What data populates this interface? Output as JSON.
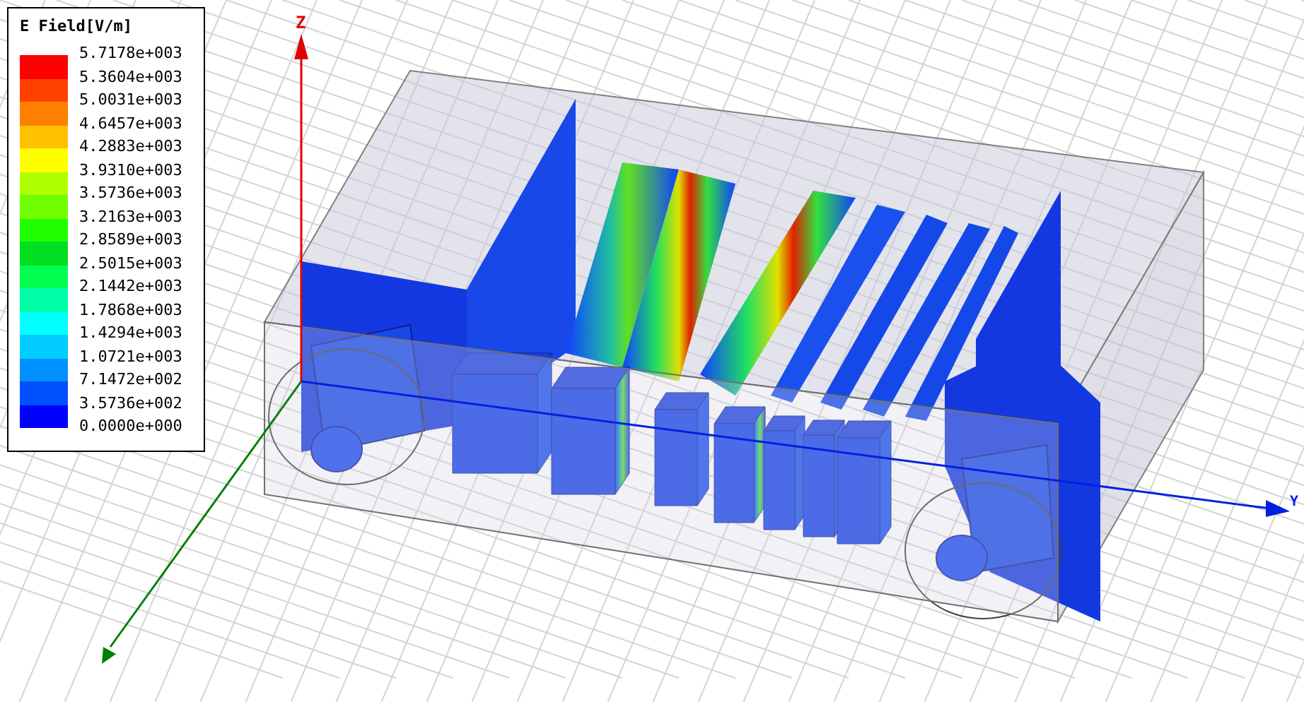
{
  "legend": {
    "title": "E Field[V/m]",
    "bands": [
      {
        "color": "#ff0000"
      },
      {
        "color": "#ff4000"
      },
      {
        "color": "#ff8000"
      },
      {
        "color": "#ffc000"
      },
      {
        "color": "#ffff00"
      },
      {
        "color": "#b0ff00"
      },
      {
        "color": "#70ff00"
      },
      {
        "color": "#20ff00"
      },
      {
        "color": "#00e020"
      },
      {
        "color": "#00ff50"
      },
      {
        "color": "#00ffa8"
      },
      {
        "color": "#00ffff"
      },
      {
        "color": "#00ccff"
      },
      {
        "color": "#0090ff"
      },
      {
        "color": "#0050ff"
      },
      {
        "color": "#0000ff"
      }
    ],
    "labels": [
      "5.7178e+003",
      "5.3604e+003",
      "5.0031e+003",
      "4.6457e+003",
      "4.2883e+003",
      "3.9310e+003",
      "3.5736e+003",
      "3.2163e+003",
      "2.8589e+003",
      "2.5015e+003",
      "2.1442e+003",
      "1.7868e+003",
      "1.4294e+003",
      "1.0721e+003",
      "7.1472e+002",
      "3.5736e+002",
      "0.0000e+000"
    ]
  },
  "axes": [
    {
      "kind": "z",
      "label": "Z"
    },
    {
      "kind": "y",
      "label": "Y"
    },
    {
      "kind": "x"
    }
  ]
}
